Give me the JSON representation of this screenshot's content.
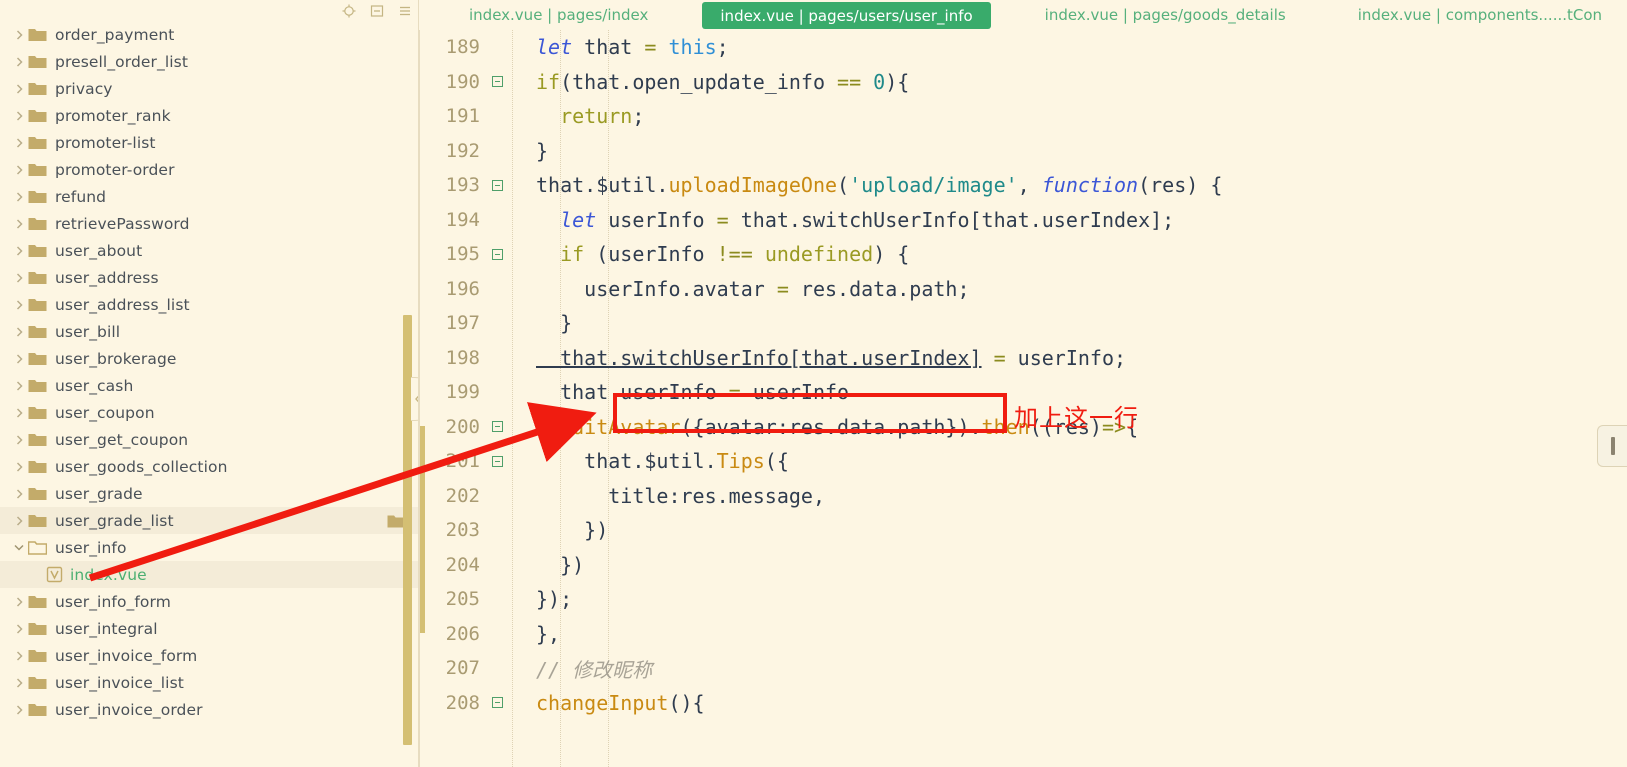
{
  "sidebar": {
    "toolbar": [
      {
        "name": "locate-file-icon",
        "label": "locate"
      },
      {
        "name": "collapse-all-icon",
        "label": "collapse all"
      },
      {
        "name": "menu-icon",
        "label": "menu"
      }
    ],
    "items": [
      {
        "label": "order_payment",
        "type": "folder",
        "expanded": false,
        "indent": 1,
        "state": "normal"
      },
      {
        "label": "presell_order_list",
        "type": "folder",
        "expanded": false,
        "indent": 1,
        "state": "normal"
      },
      {
        "label": "privacy",
        "type": "folder",
        "expanded": false,
        "indent": 1,
        "state": "normal"
      },
      {
        "label": "promoter_rank",
        "type": "folder",
        "expanded": false,
        "indent": 1,
        "state": "normal"
      },
      {
        "label": "promoter-list",
        "type": "folder",
        "expanded": false,
        "indent": 1,
        "state": "normal"
      },
      {
        "label": "promoter-order",
        "type": "folder",
        "expanded": false,
        "indent": 1,
        "state": "normal"
      },
      {
        "label": "refund",
        "type": "folder",
        "expanded": false,
        "indent": 1,
        "state": "normal"
      },
      {
        "label": "retrievePassword",
        "type": "folder",
        "expanded": false,
        "indent": 1,
        "state": "normal"
      },
      {
        "label": "user_about",
        "type": "folder",
        "expanded": false,
        "indent": 1,
        "state": "normal"
      },
      {
        "label": "user_address",
        "type": "folder",
        "expanded": false,
        "indent": 1,
        "state": "normal"
      },
      {
        "label": "user_address_list",
        "type": "folder",
        "expanded": false,
        "indent": 1,
        "state": "normal"
      },
      {
        "label": "user_bill",
        "type": "folder",
        "expanded": false,
        "indent": 1,
        "state": "normal"
      },
      {
        "label": "user_brokerage",
        "type": "folder",
        "expanded": false,
        "indent": 1,
        "state": "normal"
      },
      {
        "label": "user_cash",
        "type": "folder",
        "expanded": false,
        "indent": 1,
        "state": "normal"
      },
      {
        "label": "user_coupon",
        "type": "folder",
        "expanded": false,
        "indent": 1,
        "state": "normal"
      },
      {
        "label": "user_get_coupon",
        "type": "folder",
        "expanded": false,
        "indent": 1,
        "state": "normal"
      },
      {
        "label": "user_goods_collection",
        "type": "folder",
        "expanded": false,
        "indent": 1,
        "state": "normal"
      },
      {
        "label": "user_grade",
        "type": "folder",
        "expanded": false,
        "indent": 1,
        "state": "normal"
      },
      {
        "label": "user_grade_list",
        "type": "folder",
        "expanded": false,
        "indent": 1,
        "state": "hovered"
      },
      {
        "label": "user_info",
        "type": "folder",
        "expanded": true,
        "indent": 1,
        "state": "normal"
      },
      {
        "label": "index.vue",
        "type": "vue",
        "expanded": false,
        "indent": 2,
        "state": "selected"
      },
      {
        "label": "user_info_form",
        "type": "folder",
        "expanded": false,
        "indent": 1,
        "state": "normal"
      },
      {
        "label": "user_integral",
        "type": "folder",
        "expanded": false,
        "indent": 1,
        "state": "normal"
      },
      {
        "label": "user_invoice_form",
        "type": "folder",
        "expanded": false,
        "indent": 1,
        "state": "normal"
      },
      {
        "label": "user_invoice_list",
        "type": "folder",
        "expanded": false,
        "indent": 1,
        "state": "normal"
      },
      {
        "label": "user_invoice_order",
        "type": "folder",
        "expanded": false,
        "indent": 1,
        "state": "normal"
      }
    ]
  },
  "tabs": [
    {
      "label": "index.vue | pages/index",
      "active": false
    },
    {
      "label": "index.vue | pages/users/user_info",
      "active": true
    },
    {
      "label": "index.vue | pages/goods_details",
      "active": false
    },
    {
      "label": "index.vue | components......tCon",
      "active": false
    }
  ],
  "editor": {
    "first_line": 189,
    "lines": [
      {
        "n": 189,
        "fold": false,
        "indent": 4,
        "tokens": [
          {
            "t": "let ",
            "c": "kw"
          },
          {
            "t": "that ",
            "c": "plain"
          },
          {
            "t": "= ",
            "c": "op"
          },
          {
            "t": "this",
            "c": "kw2"
          },
          {
            "t": ";",
            "c": "plain"
          }
        ]
      },
      {
        "n": 190,
        "fold": true,
        "indent": 4,
        "tokens": [
          {
            "t": "if",
            "c": "ctrl"
          },
          {
            "t": "(that.open_update_info ",
            "c": "plain"
          },
          {
            "t": "== ",
            "c": "op"
          },
          {
            "t": "0",
            "c": "num"
          },
          {
            "t": "){",
            "c": "plain"
          }
        ]
      },
      {
        "n": 191,
        "fold": false,
        "indent": 5,
        "tokens": [
          {
            "t": "  ",
            "c": "plain"
          },
          {
            "t": "return",
            "c": "ctrl"
          },
          {
            "t": ";",
            "c": "plain"
          }
        ]
      },
      {
        "n": 192,
        "fold": false,
        "indent": 4,
        "tokens": [
          {
            "t": "}",
            "c": "plain"
          }
        ]
      },
      {
        "n": 193,
        "fold": true,
        "indent": 4,
        "tokens": [
          {
            "t": "that.$util.",
            "c": "plain"
          },
          {
            "t": "uploadImageOne",
            "c": "fn"
          },
          {
            "t": "(",
            "c": "plain"
          },
          {
            "t": "'upload/image'",
            "c": "str"
          },
          {
            "t": ", ",
            "c": "plain"
          },
          {
            "t": "function",
            "c": "kw"
          },
          {
            "t": "(res) {",
            "c": "plain"
          }
        ]
      },
      {
        "n": 194,
        "fold": false,
        "indent": 5,
        "tokens": [
          {
            "t": "  ",
            "c": "plain"
          },
          {
            "t": "let ",
            "c": "kw"
          },
          {
            "t": "userInfo ",
            "c": "plain"
          },
          {
            "t": "= ",
            "c": "op"
          },
          {
            "t": "that.switchUserInfo[that.userIndex];",
            "c": "plain"
          }
        ]
      },
      {
        "n": 195,
        "fold": true,
        "indent": 5,
        "tokens": [
          {
            "t": "  ",
            "c": "plain"
          },
          {
            "t": "if",
            "c": "ctrl"
          },
          {
            "t": " (userInfo ",
            "c": "plain"
          },
          {
            "t": "!== ",
            "c": "op"
          },
          {
            "t": "undefined",
            "c": "ctrl"
          },
          {
            "t": ") {",
            "c": "plain"
          }
        ]
      },
      {
        "n": 196,
        "fold": false,
        "indent": 6,
        "tokens": [
          {
            "t": "    userInfo.avatar ",
            "c": "plain"
          },
          {
            "t": "= ",
            "c": "op"
          },
          {
            "t": "res.data.path;",
            "c": "plain"
          }
        ]
      },
      {
        "n": 197,
        "fold": false,
        "indent": 5,
        "tokens": [
          {
            "t": "  }",
            "c": "plain"
          }
        ]
      },
      {
        "n": 198,
        "fold": false,
        "indent": 5,
        "tokens": [
          {
            "t": "  that.switchUserInfo[that.userIndex]",
            "c": "plain ul"
          },
          {
            "t": " ",
            "c": "plain"
          },
          {
            "t": "= ",
            "c": "op"
          },
          {
            "t": "userInfo;",
            "c": "plain"
          }
        ]
      },
      {
        "n": 199,
        "fold": false,
        "indent": 5,
        "tokens": [
          {
            "t": "  that.userInfo ",
            "c": "plain"
          },
          {
            "t": "= ",
            "c": "op"
          },
          {
            "t": "userInfo",
            "c": "plain"
          }
        ]
      },
      {
        "n": 200,
        "fold": true,
        "indent": 5,
        "tokens": [
          {
            "t": "  ",
            "c": "plain"
          },
          {
            "t": "editAvatar",
            "c": "fn"
          },
          {
            "t": "({avatar:res.data.path}).",
            "c": "plain"
          },
          {
            "t": "then",
            "c": "fn"
          },
          {
            "t": "((res)",
            "c": "plain"
          },
          {
            "t": "=>",
            "c": "op"
          },
          {
            "t": "{",
            "c": "plain"
          }
        ]
      },
      {
        "n": 201,
        "fold": true,
        "indent": 6,
        "tokens": [
          {
            "t": "    that.$util.",
            "c": "plain"
          },
          {
            "t": "Tips",
            "c": "fn"
          },
          {
            "t": "({",
            "c": "plain"
          }
        ]
      },
      {
        "n": 202,
        "fold": false,
        "indent": 7,
        "tokens": [
          {
            "t": "      title:res.message,",
            "c": "plain"
          }
        ]
      },
      {
        "n": 203,
        "fold": false,
        "indent": 6,
        "tokens": [
          {
            "t": "    })",
            "c": "plain"
          }
        ]
      },
      {
        "n": 204,
        "fold": false,
        "indent": 5,
        "tokens": [
          {
            "t": "  })",
            "c": "plain"
          }
        ]
      },
      {
        "n": 205,
        "fold": false,
        "indent": 4,
        "tokens": [
          {
            "t": "});",
            "c": "plain"
          }
        ]
      },
      {
        "n": 206,
        "fold": false,
        "indent": 3,
        "tokens": [
          {
            "t": "},",
            "c": "plain"
          }
        ]
      },
      {
        "n": 207,
        "fold": false,
        "indent": 3,
        "tokens": [
          {
            "t": "// 修改昵称",
            "c": "com"
          }
        ]
      },
      {
        "n": 208,
        "fold": true,
        "indent": 3,
        "tokens": [
          {
            "t": "changeInput",
            "c": "fn"
          },
          {
            "t": "(){",
            "c": "plain"
          }
        ]
      }
    ]
  },
  "annotation": {
    "note_text": "加上这一行",
    "highlight_color": "#f01c10",
    "boxed_code": "that.userInfo = userInfo"
  },
  "colors": {
    "background": "#fdf6e3",
    "active_tab": "#39ab6b",
    "tab_text": "#56b07c",
    "folder": "#c3ab6a",
    "tree_text": "#4a5158",
    "vue_green": "#4caf72",
    "annotation_red": "#f01c10",
    "scrollbar": "#d4bf73"
  }
}
